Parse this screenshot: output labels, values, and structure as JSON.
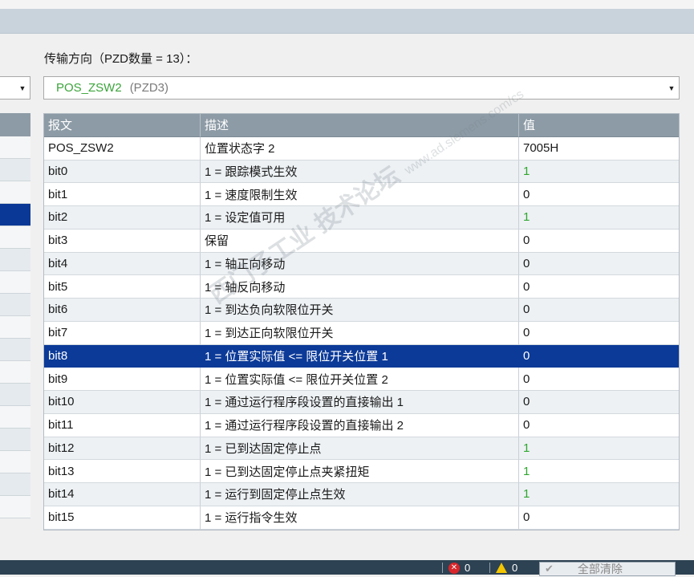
{
  "section": {
    "direction_label": "传输方向（PZD数量 = 13）："
  },
  "dropdown": {
    "selected_name": "POS_ZSW2",
    "selected_pzd": "(PZD3)"
  },
  "table": {
    "headers": [
      "报文",
      "描述",
      "值"
    ],
    "rows": [
      {
        "telegram": "POS_ZSW2",
        "description": "位置状态字 2",
        "value": "7005H",
        "value_color": "normal"
      },
      {
        "telegram": "bit0",
        "description": "1 = 跟踪模式生效",
        "value": "1",
        "value_color": "green"
      },
      {
        "telegram": "bit1",
        "description": "1 = 速度限制生效",
        "value": "0",
        "value_color": "normal"
      },
      {
        "telegram": "bit2",
        "description": "1 = 设定值可用",
        "value": "1",
        "value_color": "green"
      },
      {
        "telegram": "bit3",
        "description": "保留",
        "value": "0",
        "value_color": "normal"
      },
      {
        "telegram": "bit4",
        "description": "1 = 轴正向移动",
        "value": "0",
        "value_color": "normal"
      },
      {
        "telegram": "bit5",
        "description": "1 = 轴反向移动",
        "value": "0",
        "value_color": "normal"
      },
      {
        "telegram": "bit6",
        "description": "1 = 到达负向软限位开关",
        "value": "0",
        "value_color": "normal"
      },
      {
        "telegram": "bit7",
        "description": "1 = 到达正向软限位开关",
        "value": "0",
        "value_color": "normal"
      },
      {
        "telegram": "bit8",
        "description": "1 = 位置实际值 <= 限位开关位置 1",
        "value": "0",
        "value_color": "normal",
        "selected": true
      },
      {
        "telegram": "bit9",
        "description": "1 = 位置实际值 <= 限位开关位置 2",
        "value": "0",
        "value_color": "normal"
      },
      {
        "telegram": "bit10",
        "description": "1 = 通过运行程序段设置的直接输出 1",
        "value": "0",
        "value_color": "normal"
      },
      {
        "telegram": "bit11",
        "description": "1 = 通过运行程序段设置的直接输出 2",
        "value": "0",
        "value_color": "normal"
      },
      {
        "telegram": "bit12",
        "description": "1 = 已到达固定停止点",
        "value": "1",
        "value_color": "green"
      },
      {
        "telegram": "bit13",
        "description": "1 = 已到达固定停止点夹紧扭矩",
        "value": "1",
        "value_color": "green"
      },
      {
        "telegram": "bit14",
        "description": "1 = 运行到固定停止点生效",
        "value": "1",
        "value_color": "green"
      },
      {
        "telegram": "bit15",
        "description": "1 = 运行指令生效",
        "value": "0",
        "value_color": "normal"
      }
    ]
  },
  "watermark": {
    "text": "西门子工业 技术论坛",
    "sub": "www.ad.siemens.com/cs"
  },
  "statusbar": {
    "error_count": "0",
    "warning_count": "0",
    "clear_all_label": "全部清除"
  },
  "colors": {
    "header_bg": "#8d9ba6",
    "selected_bg": "#0c3a98",
    "green": "#2fa62f",
    "status_bg": "#2d4253"
  },
  "icons": {
    "error": "error-circle-icon",
    "warning": "warning-triangle-icon",
    "clear": "check-icon",
    "dropdown": "chevron-down-icon"
  }
}
